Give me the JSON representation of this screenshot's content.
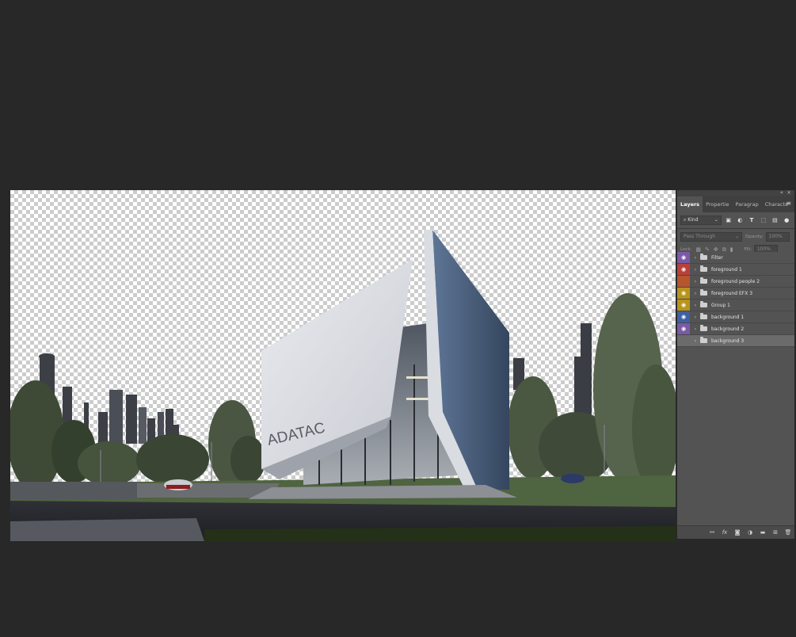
{
  "canvas": {
    "building_sign": "ADATAC"
  },
  "panel": {
    "collapse_glyph": "«",
    "close_glyph": "×",
    "menu_glyph": "≡",
    "tabs": [
      {
        "label": "Layers",
        "active": true
      },
      {
        "label": "Propertie",
        "active": false
      },
      {
        "label": "Paragrap",
        "active": false
      },
      {
        "label": "Characte",
        "active": false
      }
    ],
    "filter": {
      "search_glyph": "⌕",
      "kind_label": "Kind",
      "icons": [
        "image-filter-icon",
        "adjustment-filter-icon",
        "type-filter-icon",
        "shape-filter-icon",
        "smart-object-filter-icon",
        "filter-toggle-icon"
      ]
    },
    "blend": {
      "mode": "Pass Through",
      "opacity_label": "Opacity:",
      "opacity_value": "100%"
    },
    "lock": {
      "label": "Lock:",
      "fill_label": "Fill:",
      "fill_value": "100%"
    },
    "layers": [
      {
        "name": "Filter",
        "color": "#7a5aa6",
        "visible": true,
        "selected": false
      },
      {
        "name": "foreground 1",
        "color": "#b8413b",
        "visible": true,
        "selected": false
      },
      {
        "name": "foreground people 2",
        "color": "#b5562c",
        "visible": false,
        "selected": false
      },
      {
        "name": "foreground EFX 3",
        "color": "#b8941f",
        "visible": true,
        "selected": false
      },
      {
        "name": "Group 1",
        "color": "#b8941f",
        "visible": true,
        "selected": false
      },
      {
        "name": "background 1",
        "color": "#3f61a2",
        "visible": true,
        "selected": false
      },
      {
        "name": "background 2",
        "color": "#7a5aa6",
        "visible": true,
        "selected": false
      },
      {
        "name": "background 3",
        "color": "#6b6b6b",
        "visible": false,
        "selected": true
      }
    ],
    "footer_icons": [
      "link-layers-icon",
      "fx-icon",
      "add-mask-icon",
      "adjustment-layer-icon",
      "new-group-icon",
      "new-layer-icon",
      "delete-layer-icon"
    ]
  }
}
